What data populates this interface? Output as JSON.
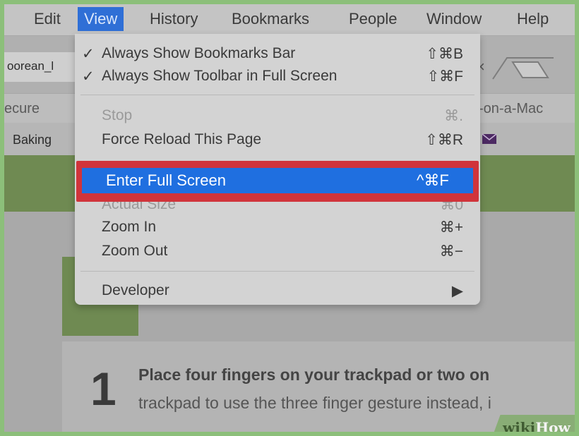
{
  "menubar": {
    "edit": "Edit",
    "view": "View",
    "history": "History",
    "bookmarks": "Bookmarks",
    "people": "People",
    "window": "Window",
    "help": "Help"
  },
  "browser": {
    "tab_title_fragment": "oorean_l",
    "secure_label": "ecure",
    "url_fragment": "-on-a-Mac",
    "bookmark_label": "Baking"
  },
  "view_menu": {
    "items": [
      {
        "check": "✓",
        "label": "Always Show Bookmarks Bar",
        "shortcut": "⇧⌘B"
      },
      {
        "check": "✓",
        "label": "Always Show Toolbar in Full Screen",
        "shortcut": "⇧⌘F"
      },
      {
        "check": "",
        "label": "Stop",
        "shortcut": "⌘."
      },
      {
        "check": "",
        "label": "Force Reload This Page",
        "shortcut": "⇧⌘R"
      },
      {
        "check": "",
        "label": "Enter Full Screen",
        "shortcut": "^⌘F"
      },
      {
        "check": "",
        "label": "Actual Size",
        "shortcut": "⌘0"
      },
      {
        "check": "",
        "label": "Zoom In",
        "shortcut": "⌘+"
      },
      {
        "check": "",
        "label": "Zoom Out",
        "shortcut": "⌘−"
      },
      {
        "check": "",
        "label": "Developer",
        "shortcut": "▶"
      }
    ]
  },
  "article": {
    "step_number": "1",
    "line1": "Place four fingers on your trackpad or two on",
    "line2": "trackpad to use the three finger gesture instead, i"
  },
  "watermark": {
    "part1": "wiki",
    "part2": "How"
  },
  "colors": {
    "highlight": "#1f6fe0",
    "annotation_box": "#d0343b",
    "site_green": "#6f8a52"
  }
}
